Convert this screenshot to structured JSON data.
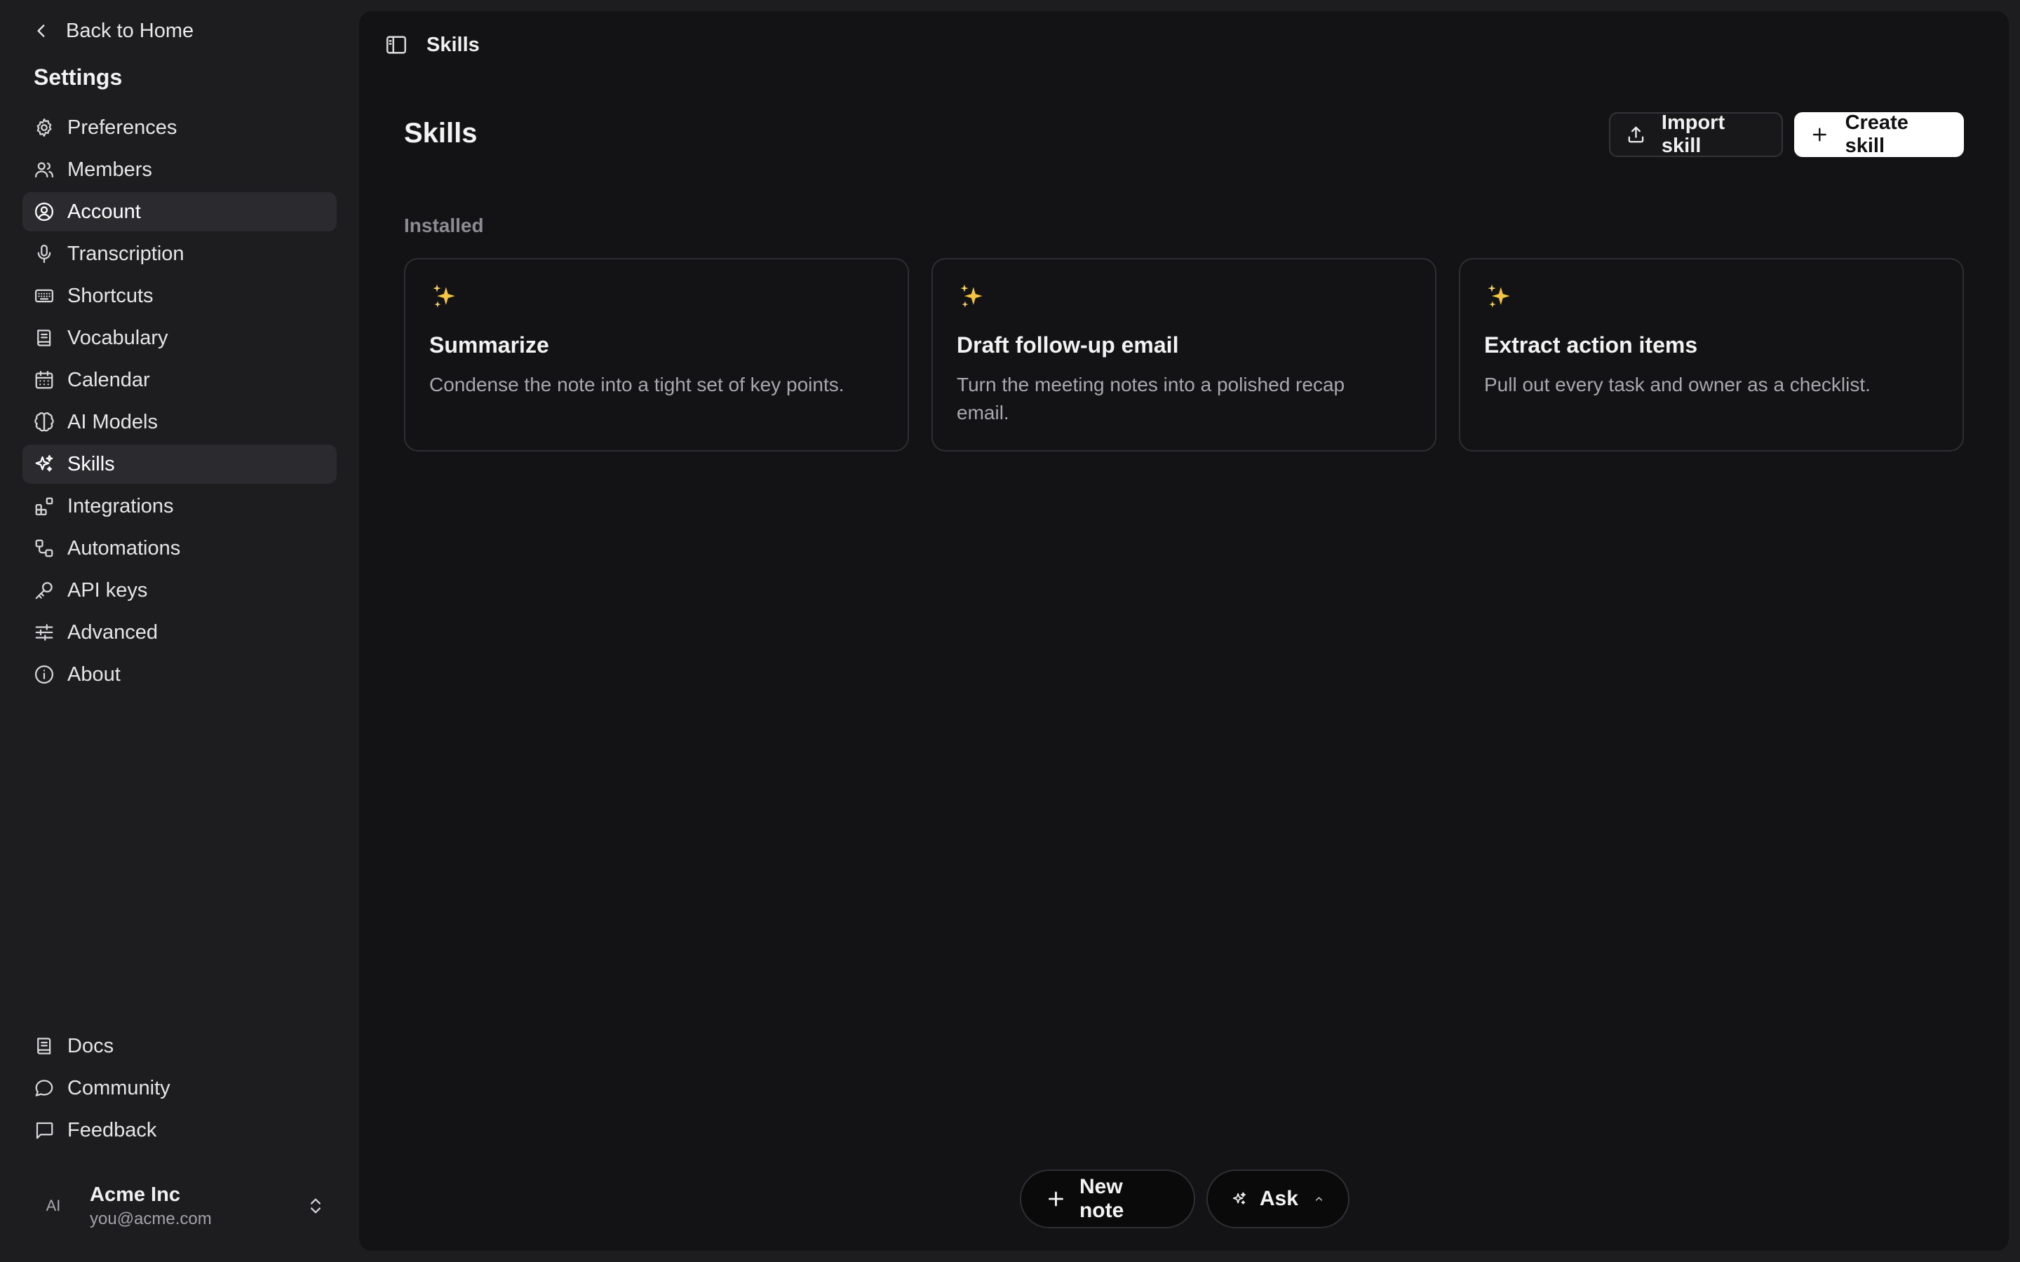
{
  "sidebar": {
    "back_label": "Back to Home",
    "settings_title": "Settings",
    "items": [
      {
        "label": "Preferences",
        "icon": "gear-icon"
      },
      {
        "label": "Members",
        "icon": "users-icon"
      },
      {
        "label": "Account",
        "icon": "user-circle-icon"
      },
      {
        "label": "Transcription",
        "icon": "microphone-icon"
      },
      {
        "label": "Shortcuts",
        "icon": "keyboard-icon"
      },
      {
        "label": "Vocabulary",
        "icon": "book-icon"
      },
      {
        "label": "Calendar",
        "icon": "calendar-icon"
      },
      {
        "label": "AI Models",
        "icon": "brain-icon"
      },
      {
        "label": "Skills",
        "icon": "sparkles-icon"
      },
      {
        "label": "Integrations",
        "icon": "blocks-icon"
      },
      {
        "label": "Automations",
        "icon": "workflow-icon"
      },
      {
        "label": "API keys",
        "icon": "key-icon"
      },
      {
        "label": "Advanced",
        "icon": "sliders-icon"
      },
      {
        "label": "About",
        "icon": "info-icon"
      }
    ],
    "bottom_items": [
      {
        "label": "Docs",
        "icon": "document-icon"
      },
      {
        "label": "Community",
        "icon": "chat-bubble-icon"
      },
      {
        "label": "Feedback",
        "icon": "message-square-icon"
      }
    ],
    "account": {
      "initials": "AI",
      "name": "Acme Inc",
      "email": "you@acme.com"
    }
  },
  "topbar": {
    "breadcrumb": "Skills"
  },
  "main": {
    "title": "Skills",
    "import_label": "Import skill",
    "create_label": "Create skill",
    "section_label": "Installed",
    "cards": [
      {
        "title": "Summarize",
        "description": "Condense the note into a tight set of key points."
      },
      {
        "title": "Draft follow-up email",
        "description": "Turn the meeting notes into a polished recap email."
      },
      {
        "title": "Extract action items",
        "description": "Pull out every task and owner as a checklist."
      }
    ]
  },
  "footer": {
    "new_note_label": "New note",
    "ask_label": "Ask"
  },
  "colors": {
    "sidebar_bg": "#1d1d20",
    "main_bg": "#131315",
    "active_item_bg": "#2b2b2f",
    "primary_button_bg": "#ffffff",
    "sparkle": "#f5c542"
  }
}
